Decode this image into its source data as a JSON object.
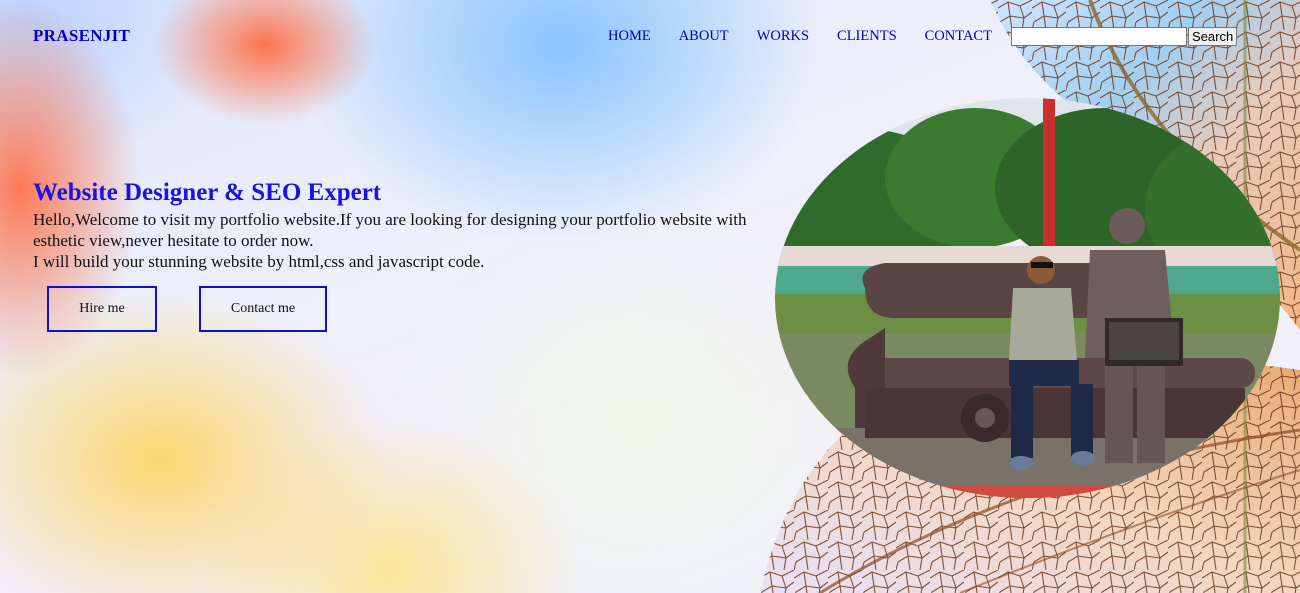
{
  "header": {
    "brand": "PRASENJIT",
    "nav": [
      {
        "label": "HOME"
      },
      {
        "label": "ABOUT"
      },
      {
        "label": "WORKS"
      },
      {
        "label": "CLIENTS"
      },
      {
        "label": "CONTACT"
      }
    ],
    "search": {
      "value": "",
      "placeholder": "",
      "button_label": "Search"
    }
  },
  "hero": {
    "title": "Website Designer & SEO Expert",
    "lines": [
      "Hello,Welcome to visit my portfolio website.If you are looking for designing your portfolio website with esthetic view,never hesitate to order now.",
      "I will build your stunning website by html,css and javascript code."
    ],
    "buttons": {
      "hire": "Hire me",
      "contact": "Contact me"
    }
  },
  "colors": {
    "accent": "#1a10e8",
    "nav_link": "#0000b8",
    "button_border": "#1010cc"
  }
}
